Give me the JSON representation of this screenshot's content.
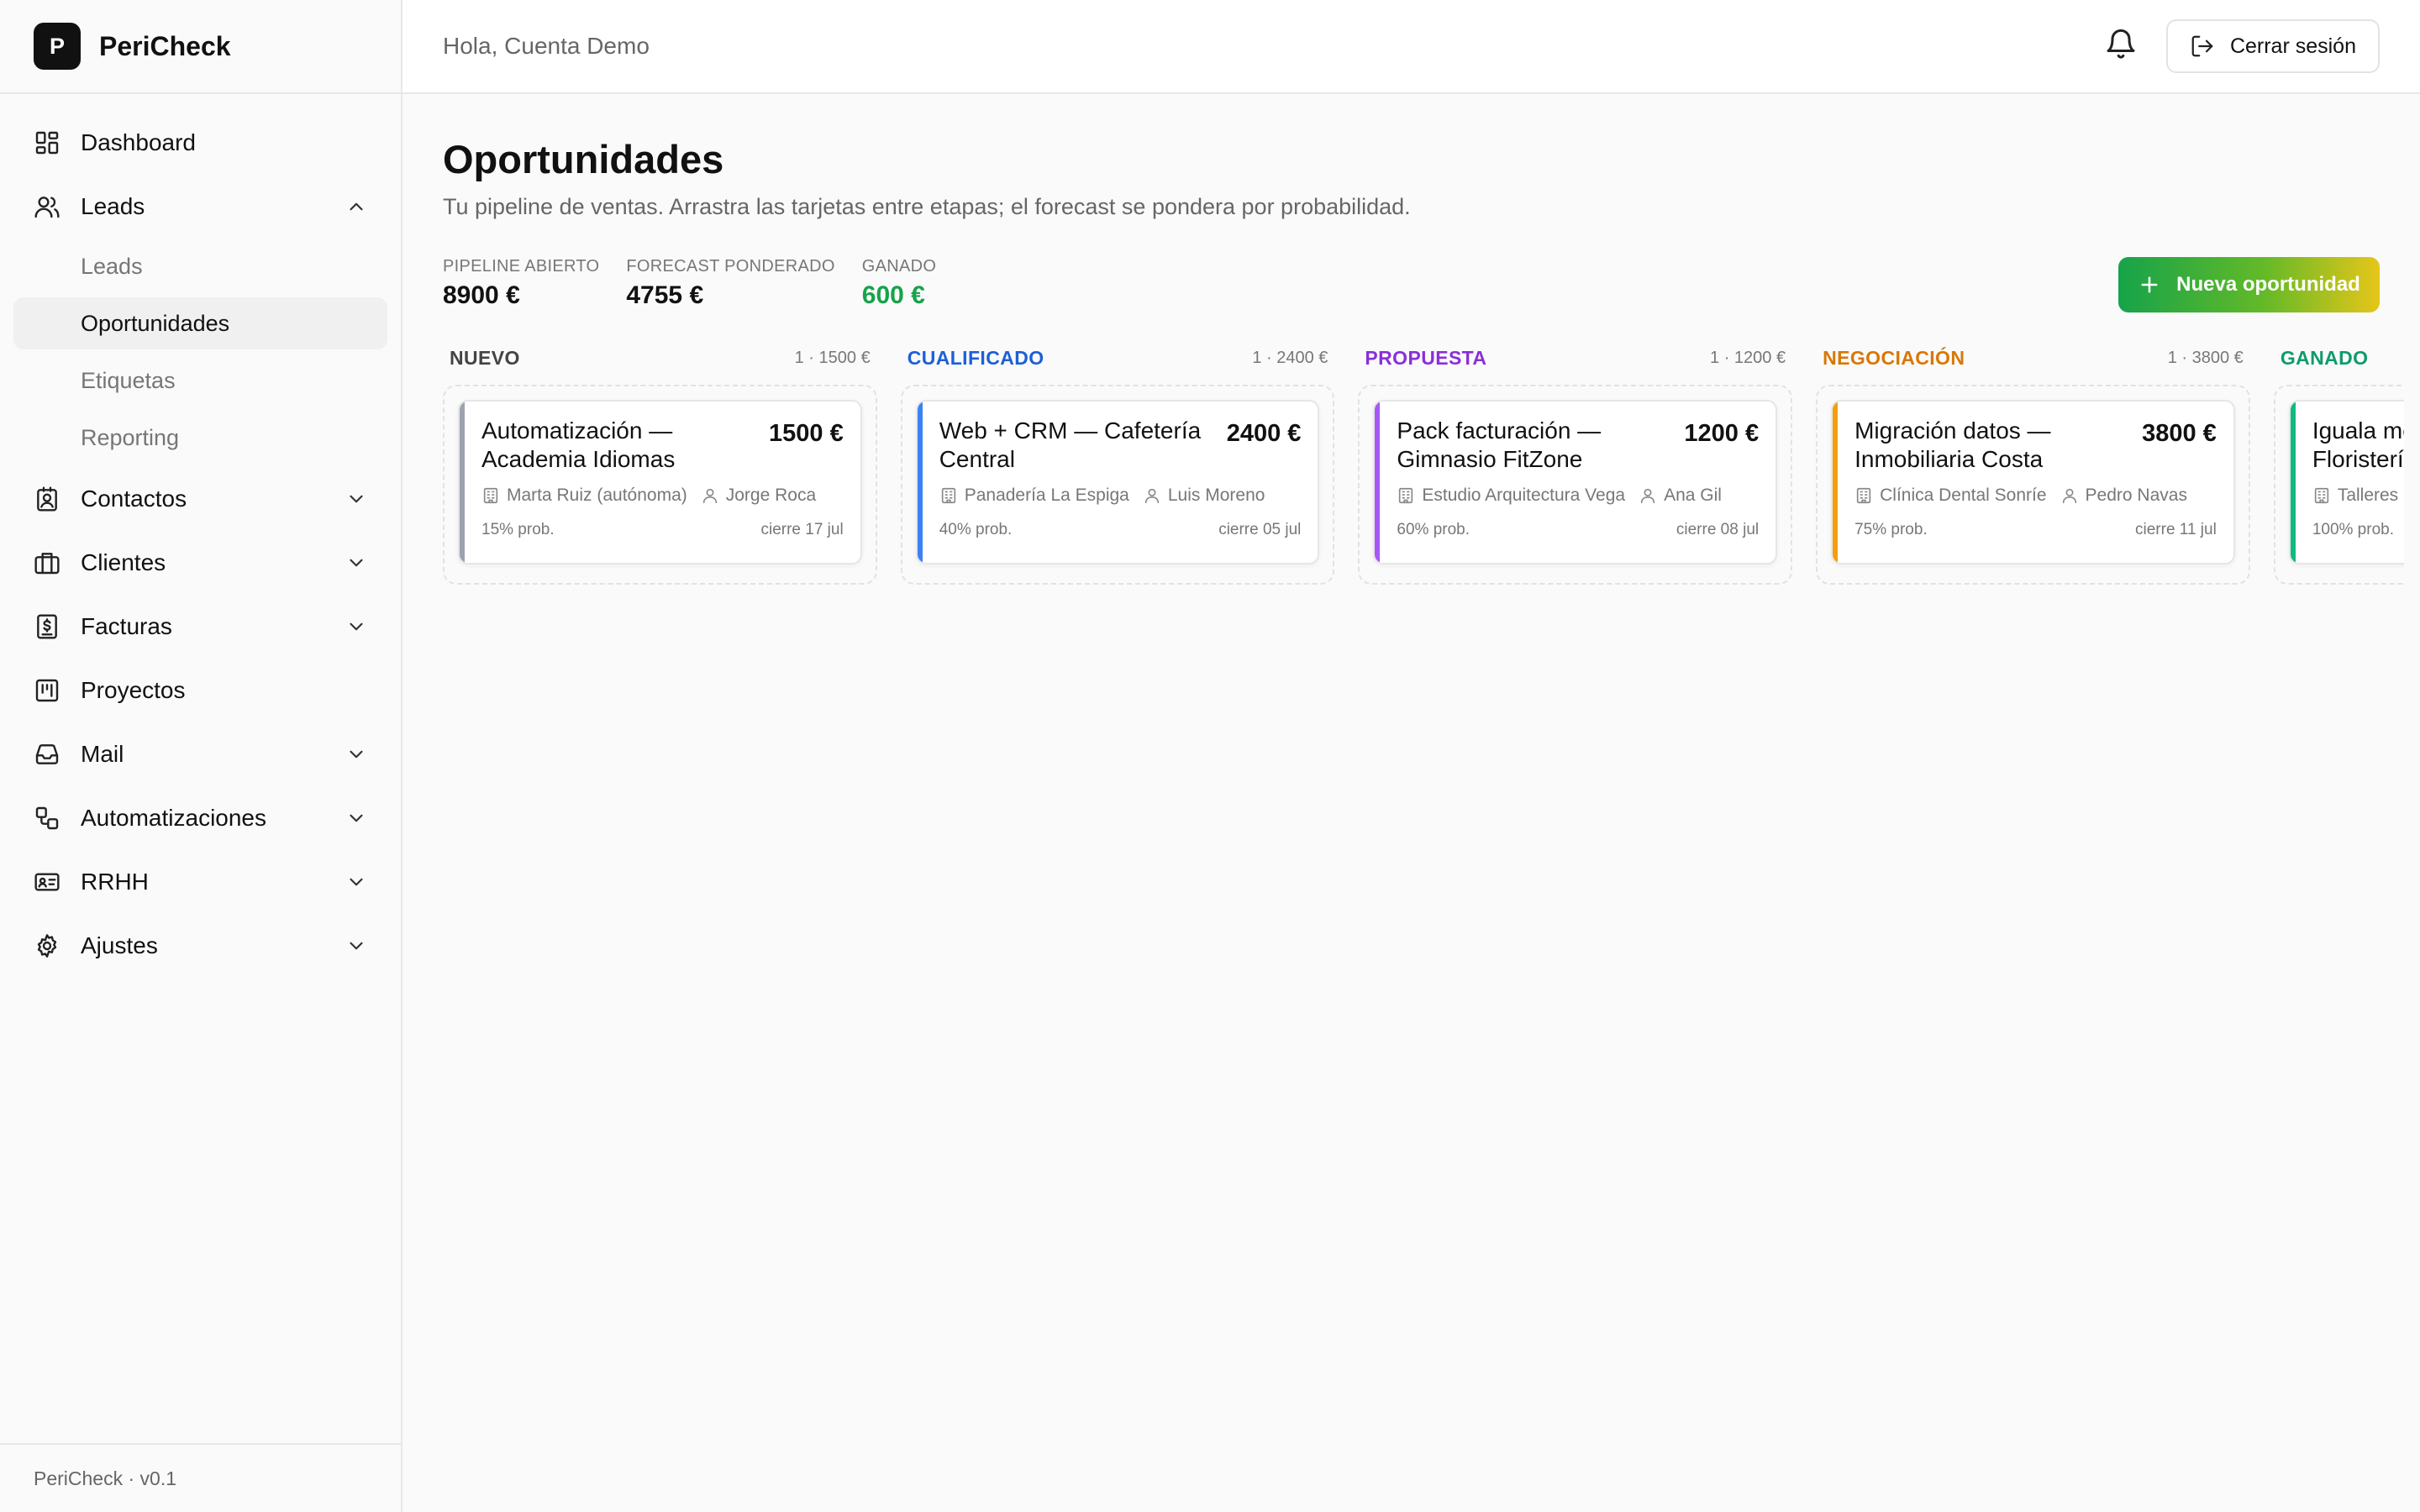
{
  "app": {
    "logo_letter": "P",
    "name": "PeriCheck",
    "version": "PeriCheck · v0.1"
  },
  "topbar": {
    "greeting": "Hola, Cuenta Demo",
    "logout_label": "Cerrar sesión"
  },
  "sidebar": {
    "dashboard": "Dashboard",
    "leads": "Leads",
    "leads_sub": [
      "Leads",
      "Oportunidades",
      "Etiquetas",
      "Reporting"
    ],
    "contactos": "Contactos",
    "clientes": "Clientes",
    "facturas": "Facturas",
    "proyectos": "Proyectos",
    "mail": "Mail",
    "automatizaciones": "Automatizaciones",
    "rrhh": "RRHH",
    "ajustes": "Ajustes"
  },
  "page": {
    "title": "Oportunidades",
    "subtitle": "Tu pipeline de ventas. Arrastra las tarjetas entre etapas; el forecast se pondera por probabilidad."
  },
  "stats": [
    {
      "label": "PIPELINE ABIERTO",
      "value": "8900 €"
    },
    {
      "label": "FORECAST PONDERADO",
      "value": "4755 €"
    },
    {
      "label": "GANADO",
      "value": "600 €"
    }
  ],
  "new_button": "Nueva oportunidad",
  "colors": {
    "nuevo": "#9ca3af",
    "cualificado": "#3b82f6",
    "propuesta": "#a855f7",
    "negociacion": "#f59e0b",
    "ganado": "#10b981",
    "title_nuevo": "#444444",
    "title_cualificado": "#1d5fd6",
    "title_propuesta": "#8b2fd9",
    "title_negociacion": "#d97706",
    "title_ganado": "#0f9b6a"
  },
  "columns": [
    {
      "title": "NUEVO",
      "meta": "1 · 1500 €",
      "card": {
        "title": "Automatización — Academia Idiomas",
        "amount": "1500 €",
        "company": "Marta Ruiz (autónoma)",
        "owner": "Jorge Roca",
        "prob": "15% prob.",
        "close": "cierre 17 jul"
      }
    },
    {
      "title": "CUALIFICADO",
      "meta": "1 · 2400 €",
      "card": {
        "title": "Web + CRM — Cafetería Central",
        "amount": "2400 €",
        "company": "Panadería La Espiga",
        "owner": "Luis Moreno",
        "prob": "40% prob.",
        "close": "cierre 05 jul"
      }
    },
    {
      "title": "PROPUESTA",
      "meta": "1 · 1200 €",
      "card": {
        "title": "Pack facturación — Gimnasio FitZone",
        "amount": "1200 €",
        "company": "Estudio Arquitectura Vega",
        "owner": "Ana Gil",
        "prob": "60% prob.",
        "close": "cierre 08 jul"
      }
    },
    {
      "title": "NEGOCIACIÓN",
      "meta": "1 · 3800 €",
      "card": {
        "title": "Migración datos — Inmobiliaria Costa",
        "amount": "3800 €",
        "company": "Clínica Dental Sonríe",
        "owner": "Pedro Navas",
        "prob": "75% prob.",
        "close": "cierre 11 jul"
      }
    },
    {
      "title": "GANADO",
      "meta": "",
      "card": {
        "title": "Iguala mensual — Floristería",
        "amount": "",
        "company": "Talleres",
        "owner": "",
        "prob": "100% prob.",
        "close": ""
      }
    }
  ]
}
